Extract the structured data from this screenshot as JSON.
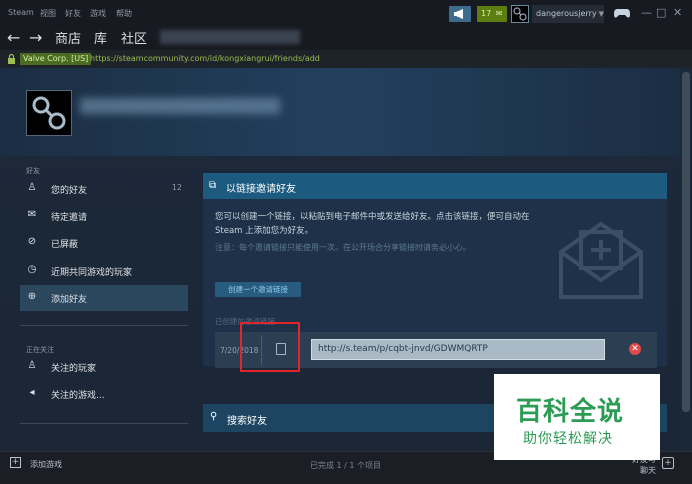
{
  "menu": {
    "items": [
      "Steam",
      "视图",
      "好友",
      "游戏",
      "帮助"
    ]
  },
  "topbar": {
    "notification_count": "17",
    "account_name": "dangerousjerry",
    "window_controls": [
      "—",
      "□",
      "✕"
    ]
  },
  "nav": {
    "store": "商店",
    "library": "库",
    "community": "社区"
  },
  "urlbar": {
    "cert": "Valve Corp. [US]",
    "url": "https://steamcommunity.com/id/kongxiangrui/friends/add"
  },
  "sidebar": {
    "friends_heading": "好友",
    "items": [
      {
        "label": "您的好友",
        "icon": "user-icon",
        "count": "12"
      },
      {
        "label": "待定邀请",
        "icon": "mail-icon"
      },
      {
        "label": "已屏蔽",
        "icon": "block-icon"
      },
      {
        "label": "近期共同游戏的玩家",
        "icon": "clock-icon"
      },
      {
        "label": "添加好友",
        "icon": "plus-circle-icon"
      }
    ],
    "following_heading": "正在关注",
    "following_items": [
      {
        "label": "关注的玩家",
        "icon": "follow-user-icon"
      },
      {
        "label": "关注的游戏...",
        "icon": "megaphone-icon"
      }
    ]
  },
  "invite": {
    "title": "以链接邀请好友",
    "description": "您可以创建一个链接，以粘贴到电子邮件中或发送给好友。点击该链接，便可自动在 Steam 上添加您为好友。",
    "note": "注意：每个邀请链接只能使用一次。在公开场合分享链接时请务必小心。",
    "create_button": "创建一个邀请链接",
    "created_label": "已创建的邀请链接",
    "link_date": "7/20/2018",
    "link_value": "http://s.team/p/cqbt-jnvd/GDWMQRTP"
  },
  "search": {
    "title": "搜索好友"
  },
  "bottombar": {
    "add_game": "添加游戏",
    "status": "已完成 1 / 1 个项目",
    "friends_chat_line1": "好友与",
    "friends_chat_line2": "聊天"
  },
  "watermark": {
    "main": "百科全说",
    "sub": "助你轻松解决"
  },
  "colors": {
    "accent": "#1d5a7f",
    "highlight": "#e0262a",
    "watermark": "#2c9c55"
  }
}
